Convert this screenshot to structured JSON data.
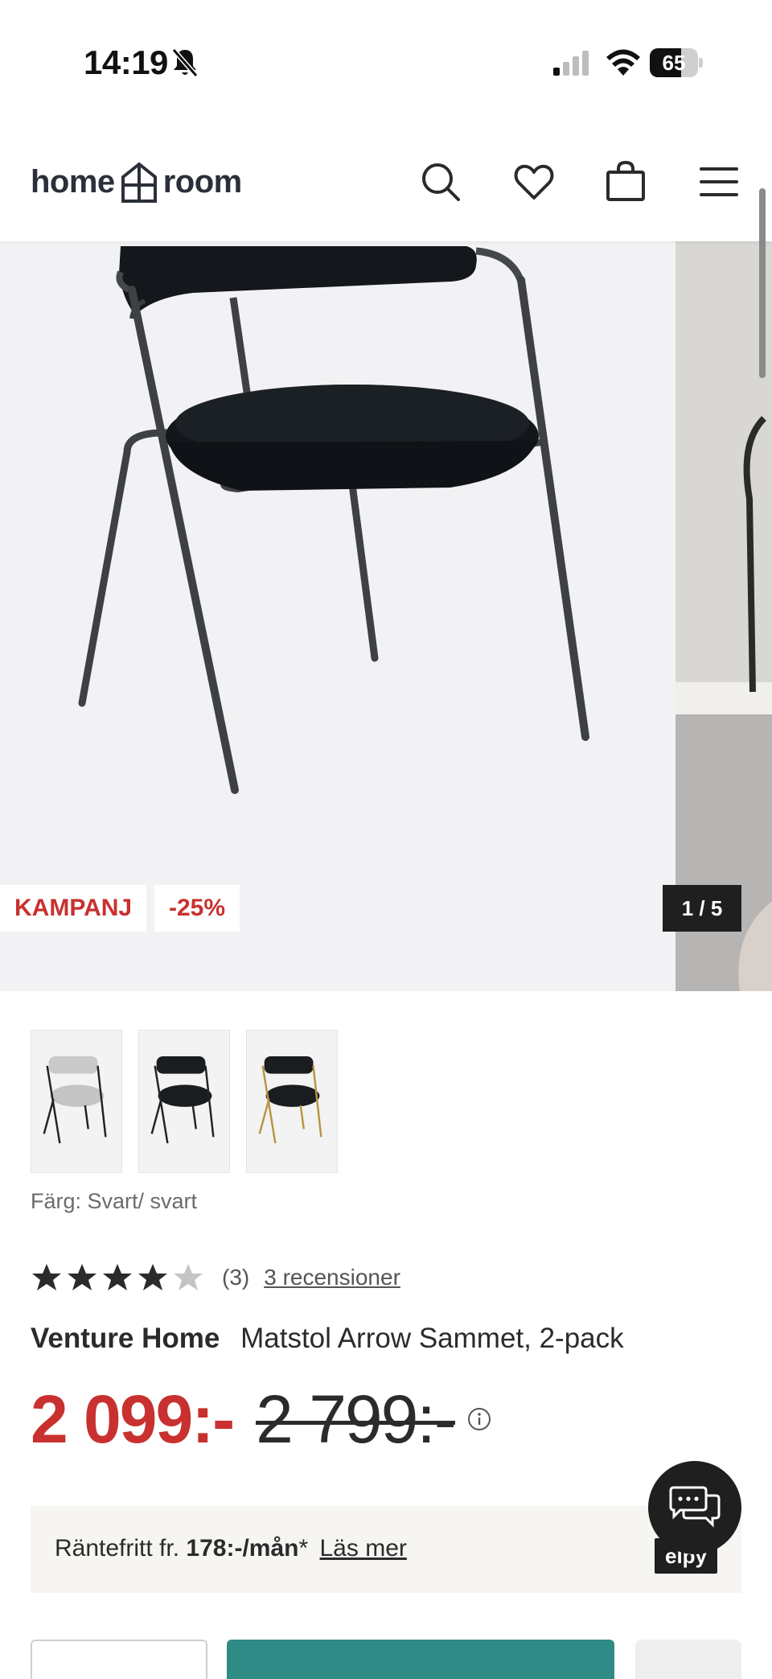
{
  "status_bar": {
    "time": "14:19",
    "battery": "65",
    "battery_level": 0.65
  },
  "header": {
    "logo_left": "home",
    "logo_right": "room",
    "icons": [
      "search-icon",
      "heart-icon",
      "shopping-bag-icon",
      "menu-icon"
    ]
  },
  "gallery": {
    "badge_campaign": "KAMPANJ",
    "badge_discount": "-25%",
    "counter": "1 / 5"
  },
  "variants": {
    "thumbnails": [
      "grey chair black legs",
      "black chair black legs",
      "black chair gold legs"
    ],
    "color_label": "Färg: Svart/ svart"
  },
  "rating": {
    "stars": 4,
    "max": 5,
    "count": "(3)",
    "reviews_link": "3 recensioner"
  },
  "product": {
    "brand": "Venture Home",
    "name": "Matstol Arrow Sammet, 2-pack"
  },
  "price": {
    "current": "2 099:-",
    "original": "2 799:-"
  },
  "financing": {
    "prefix": "Räntefritt fr.",
    "amount": "178:-/mån",
    "suffix": "*",
    "link": "Läs mer",
    "provider": "elpy"
  },
  "colors": {
    "accent_red": "#c8312f",
    "cta_teal": "#2f8b86",
    "dark": "#1f1f1f"
  }
}
